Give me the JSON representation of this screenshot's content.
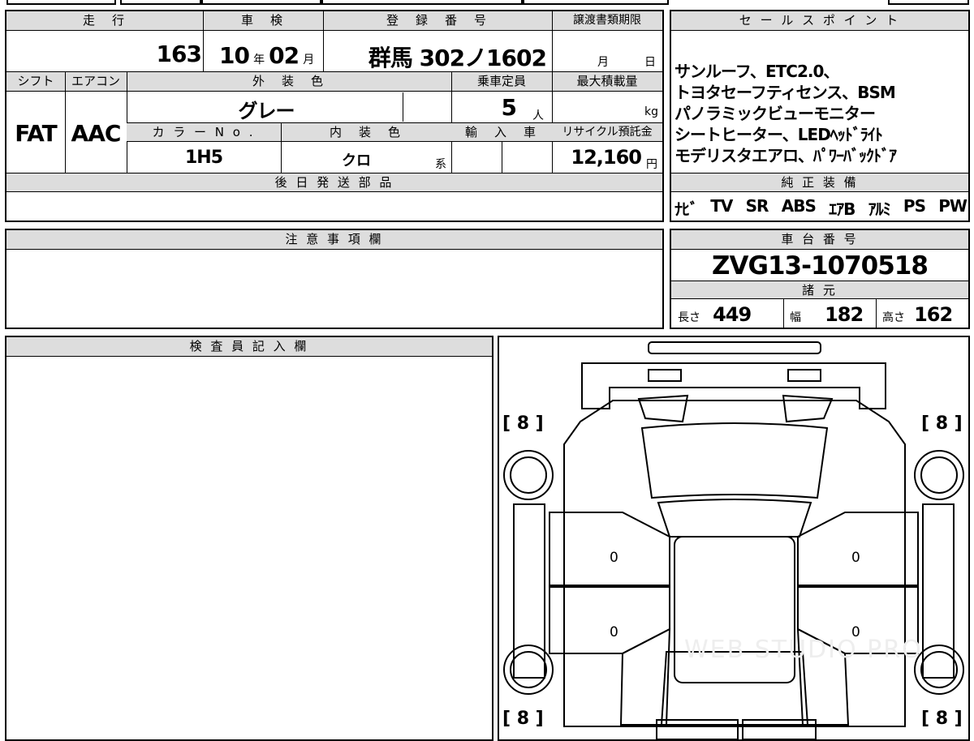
{
  "vehicle": {
    "mileage_header": "走　行",
    "mileage_value": "163 km",
    "inspection_header": "車　検",
    "inspection_year": "10",
    "inspection_year_unit": "年",
    "inspection_month": "02",
    "inspection_month_unit": "月",
    "registration_header": "登　録　番　号",
    "registration_value": "群馬 302ノ1602",
    "transfer_header": "譲渡書類期限",
    "transfer_month_unit": "月",
    "transfer_day_unit": "日",
    "shift_header": "シフト",
    "shift_value": "FAT",
    "ac_header": "エアコン",
    "ac_value": "AAC",
    "exterior_header": "外　装　色",
    "exterior_value": "グレー",
    "capacity_header": "乗車定員",
    "capacity_value": "5",
    "capacity_unit": "人",
    "maxload_header": "最大積載量",
    "maxload_unit": "kg",
    "colorno_header": "カ ラ ー N o .",
    "colorno_value": "1H5",
    "interior_header": "内　装　色",
    "interior_value": "クロ",
    "interior_unit": "系",
    "import_header": "輸　入　車",
    "recycle_header": "リサイクル預託金",
    "recycle_value": "12,160",
    "recycle_unit": "円",
    "later_parts_header": "後 日 発 送 部 品"
  },
  "sales_points": {
    "header": "セ ー ル ス ポ イ ン ト",
    "lines": [
      "サンルーフ、ETC2.0、",
      "トヨタセーフティセンス、BSM",
      "パノラミックビューモニター",
      "シートヒーター、LEDﾍｯﾄﾞﾗｲﾄ",
      "モデリスタエアロ、ﾊﾟﾜｰﾊﾞｯｸﾄﾞｱ"
    ]
  },
  "equipment": {
    "header": "純 正 装 備",
    "items": [
      "ﾅﾋﾞ",
      "TV",
      "SR",
      "ABS",
      "ｴｱB",
      "ｱﾙﾐ",
      "PS",
      "PW"
    ]
  },
  "notes": {
    "header": "注 意 事 項 欄"
  },
  "chassis": {
    "header": "車 台 番 号",
    "value": "ZVG13-1070518"
  },
  "specs": {
    "header": "諸 元",
    "length_label": "長さ",
    "length_value": "449",
    "width_label": "幅",
    "width_value": "182",
    "height_label": "高さ",
    "height_value": "162"
  },
  "inspector": {
    "header": "検 査 員 記 入 欄"
  },
  "diagram": {
    "tire_front_left": "[ 8 ]",
    "tire_front_right": "[ 8 ]",
    "tire_rear_left": "[ 8 ]",
    "tire_rear_right": "[ 8 ]",
    "door_front_left": "0",
    "door_rear_left": "0",
    "door_front_right": "0",
    "door_rear_right": "0",
    "watermark": "WEB STUDIO PRO"
  }
}
